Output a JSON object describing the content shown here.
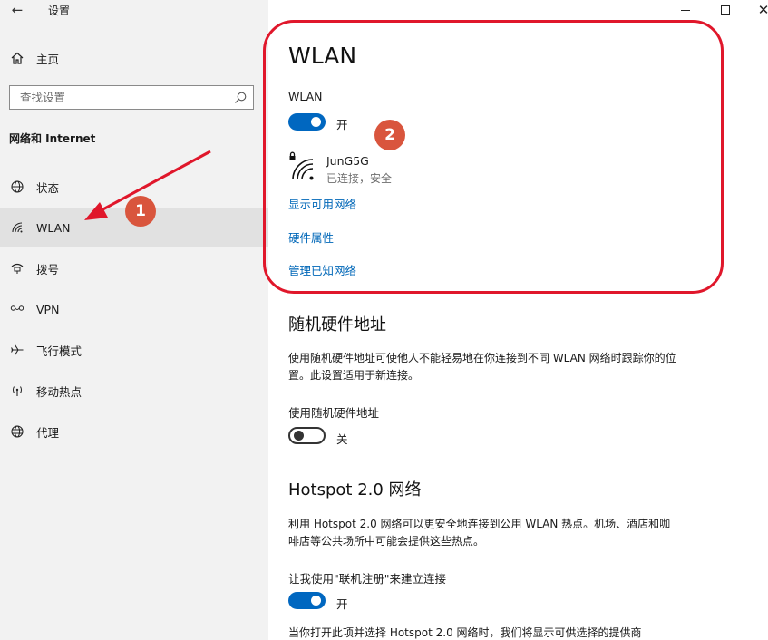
{
  "window": {
    "title": "设置",
    "back_icon": "arrow-left-icon",
    "minimize_icon": "minimize-icon",
    "maximize_icon": "maximize-icon",
    "close_icon": "close-icon"
  },
  "sidebar": {
    "home_label": "主页",
    "search_placeholder": "查找设置",
    "section_heading": "网络和 Internet",
    "items": [
      {
        "label": "状态",
        "icon": "globe-status-icon",
        "active": false
      },
      {
        "label": "WLAN",
        "icon": "wifi-icon",
        "active": true
      },
      {
        "label": "拨号",
        "icon": "dialup-phone-icon",
        "active": false
      },
      {
        "label": "VPN",
        "icon": "vpn-icon",
        "active": false
      },
      {
        "label": "飞行模式",
        "icon": "airplane-icon",
        "active": false
      },
      {
        "label": "移动热点",
        "icon": "hotspot-icon",
        "active": false
      },
      {
        "label": "代理",
        "icon": "proxy-globe-icon",
        "active": false
      }
    ]
  },
  "main": {
    "title": "WLAN",
    "wlan_label": "WLAN",
    "wlan_toggle_state": "开",
    "network": {
      "name": "JunG5G",
      "status": "已连接，安全"
    },
    "links": {
      "show_available": "显示可用网络",
      "hardware_props": "硬件属性",
      "manage_known": "管理已知网络"
    },
    "random_hw": {
      "title": "随机硬件地址",
      "desc": "使用随机硬件地址可使他人不能轻易地在你连接到不同 WLAN 网络时跟踪你的位置。此设置适用于新连接。",
      "label": "使用随机硬件地址",
      "toggle_state": "关"
    },
    "hotspot20": {
      "title": "Hotspot 2.0 网络",
      "desc": "利用 Hotspot 2.0 网络可以更安全地连接到公用 WLAN 热点。机场、酒店和咖啡店等公共场所中可能会提供这些热点。",
      "label": "让我使用\"联机注册\"来建立连接",
      "toggle_state": "开",
      "desc2": "当你打开此项并选择 Hotspot 2.0 网络时，我们将显示可供选择的提供商"
    }
  },
  "annotations": {
    "badge1": "1",
    "badge2": "2",
    "highlight_color": "#e0172b",
    "badge_color": "#d9553d"
  },
  "colors": {
    "accent": "#0067c0",
    "link": "#0067b8",
    "sidebar_bg": "#f2f2f2",
    "active_bg": "#e1e1e1"
  }
}
